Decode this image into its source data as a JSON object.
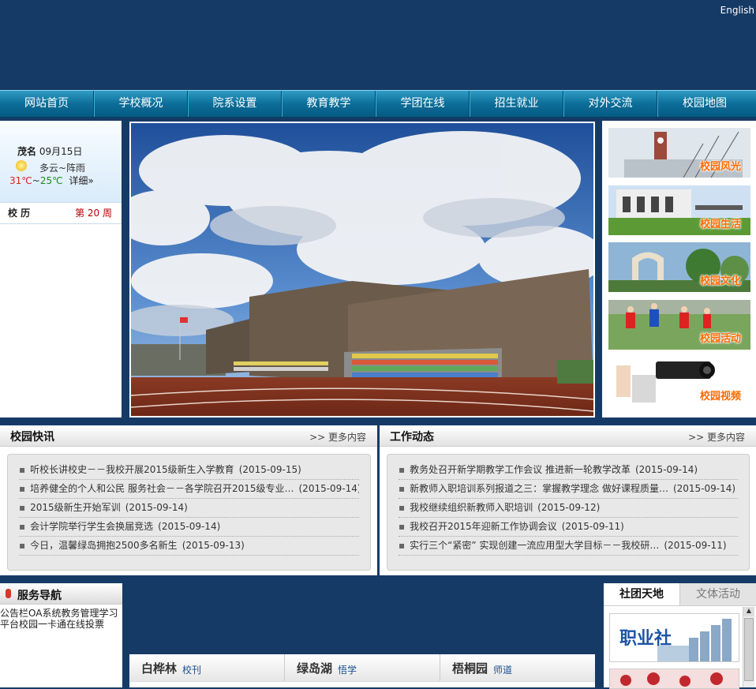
{
  "header": {
    "english_link": "English"
  },
  "nav": [
    {
      "label": "网站首页"
    },
    {
      "label": "学校概况"
    },
    {
      "label": "院系设置"
    },
    {
      "label": "教育教学"
    },
    {
      "label": "学团在线"
    },
    {
      "label": "招生就业"
    },
    {
      "label": "对外交流"
    },
    {
      "label": "校园地图"
    }
  ],
  "weather": {
    "city": "茂名",
    "date": "09月15日",
    "condition": "多云~阵雨",
    "high": "31℃",
    "sep": "~",
    "low": "25℃",
    "detail": "详细»"
  },
  "calendar": {
    "label": "校 历",
    "week": "第 20 周"
  },
  "thumbs": [
    {
      "label": "校园风光"
    },
    {
      "label": "校园生活"
    },
    {
      "label": "校园文化"
    },
    {
      "label": "校园活动"
    },
    {
      "label": "校园视频"
    }
  ],
  "news_campus": {
    "title": "校园快讯",
    "more": ">> 更多内容",
    "items": [
      {
        "text": "听校长讲校史－－我校开展2015级新生入学教育",
        "date": "(2015-09-15)"
      },
      {
        "text": "培养健全的个人和公民 服务社会－－各学院召开2015级专业…",
        "date": "(2015-09-14)"
      },
      {
        "text": "2015级新生开始军训",
        "date": "(2015-09-14)"
      },
      {
        "text": "会计学院举行学生会换届竞选",
        "date": "(2015-09-14)"
      },
      {
        "text": "今日，温馨绿岛拥抱2500多名新生",
        "date": "(2015-09-13)"
      }
    ]
  },
  "news_work": {
    "title": "工作动态",
    "more": ">> 更多内容",
    "items": [
      {
        "text": "教务处召开新学期教学工作会议 推进新一轮教学改革",
        "date": "(2015-09-14)"
      },
      {
        "text": "新教师入职培训系列报道之三：掌握教学理念 做好课程质量…",
        "date": "(2015-09-14)"
      },
      {
        "text": "我校继续组织新教师入职培训",
        "date": "(2015-09-12)"
      },
      {
        "text": "我校召开2015年迎新工作协调会议",
        "date": "(2015-09-11)"
      },
      {
        "text": "实行三个“紧密” 实现创建一流应用型大学目标－－我校研…",
        "date": "(2015-09-11)"
      }
    ]
  },
  "service": {
    "title": "服务导航",
    "links": [
      {
        "label": "公告栏"
      },
      {
        "label": "OA系统"
      },
      {
        "label": "教务管理"
      },
      {
        "label": "学习平台"
      },
      {
        "label": "校园一卡通"
      },
      {
        "label": "在线投票"
      }
    ]
  },
  "bottom": [
    {
      "title": "白桦林",
      "sub": "校刊"
    },
    {
      "title": "绿岛湖",
      "sub": "悟学"
    },
    {
      "title": "梧桐园",
      "sub": "师道"
    }
  ],
  "tabs": {
    "active": "社团天地",
    "inactive": "文体活动",
    "club_text": "职业社"
  },
  "colors": {
    "page_bg": "#163a66",
    "nav": "#0c6e99",
    "thumb_label": "#ff6a00",
    "week": "#b00000"
  }
}
